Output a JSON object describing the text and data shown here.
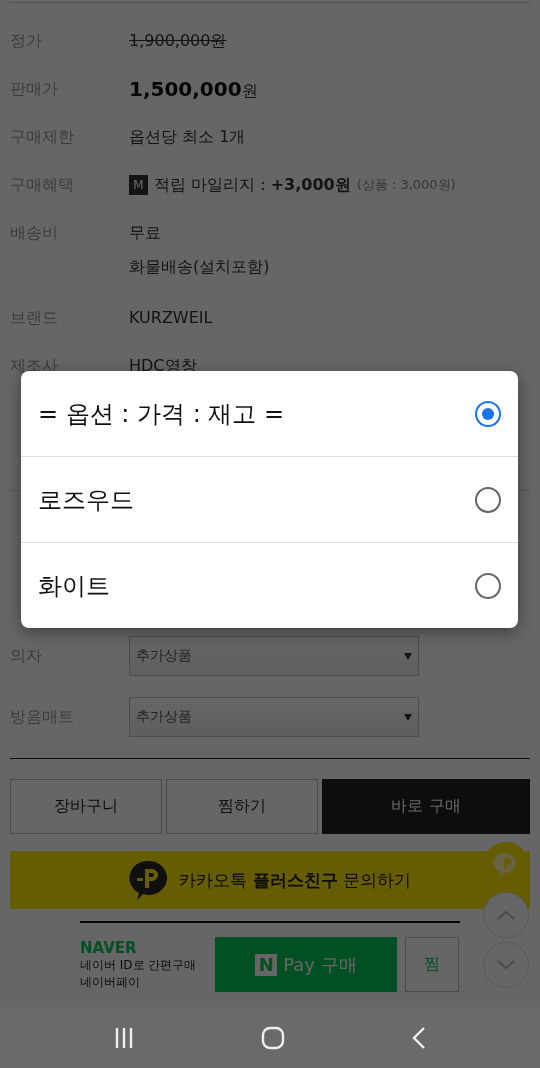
{
  "product_info": [
    {
      "kind": "strike",
      "label": "정가",
      "value": "1,900,000원"
    },
    {
      "kind": "price",
      "label": "판매가",
      "value": "1,500,000",
      "unit": "원"
    },
    {
      "kind": "text",
      "label": "구매제한",
      "value": "옵션당 최소 1개"
    },
    {
      "kind": "mileage",
      "label": "구매혜택",
      "badge": "M",
      "value": "적립 마일리지 : **+3,000원**",
      "note": "(상품 : 3,000원)"
    },
    {
      "kind": "lines",
      "label": "배송비",
      "lines": [
        "무료",
        "화물배송(설치포함)"
      ]
    },
    {
      "kind": "text",
      "label": "브랜드",
      "value": "KURZWEIL"
    },
    {
      "kind": "text",
      "label": "제조사",
      "value": "HDC영창"
    },
    {
      "kind": "divider"
    }
  ],
  "addons": [
    {
      "label": "의자",
      "value": "추가상품"
    },
    {
      "label": "방음매트",
      "value": "추가상품"
    }
  ],
  "buttons": [
    {
      "kind": "outline",
      "label": "장바구니"
    },
    {
      "kind": "outline",
      "label": "찜하기"
    },
    {
      "kind": "primary",
      "label": "바로 구매"
    }
  ],
  "kakao": {
    "label": "카카오톡 **플러스친구** 문의하기"
  },
  "naver": {
    "logo": "NAVER",
    "lines": [
      "네이버 ID로 간편구매",
      "네이버페이"
    ],
    "pay_badge": "N",
    "pay_label": "Pay 구매",
    "wish_label": "찜"
  },
  "dialog": {
    "options": [
      {
        "label": "= 옵션 : 가격 : 재고 =",
        "selected": true
      },
      {
        "label": "로즈우드",
        "selected": false
      },
      {
        "label": "화이트",
        "selected": false
      }
    ]
  }
}
